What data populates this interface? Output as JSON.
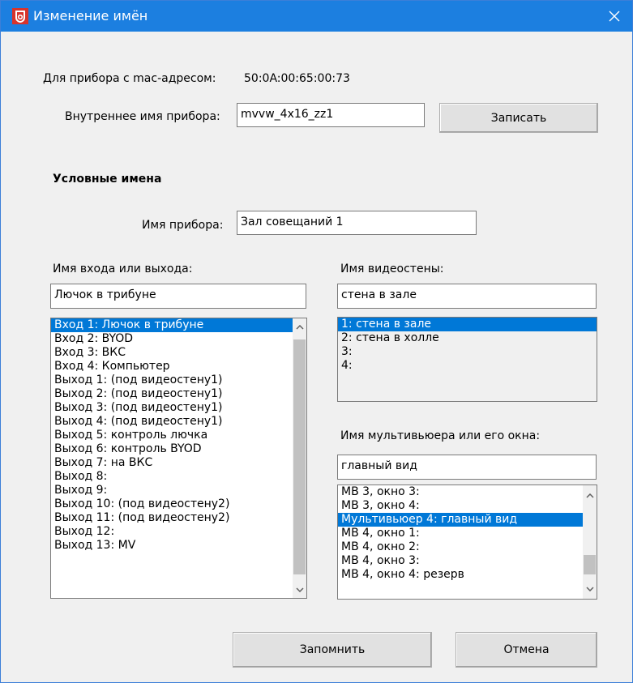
{
  "window": {
    "title": "Изменение имён"
  },
  "mac": {
    "label": "Для прибора с mac-адресом:",
    "value": "50:0A:00:65:00:73"
  },
  "internal": {
    "label": "Внутреннее имя прибора:",
    "value": "mvvw_4x16_zz1",
    "write_label": "Записать"
  },
  "conditional_header": "Условные имена",
  "device": {
    "label": "Имя прибора:",
    "value": "Зал совещаний 1"
  },
  "io": {
    "label": "Имя входа или выхода:",
    "value": "Лючок в трибуне",
    "items": [
      "Вход 1: Лючок в трибуне",
      "Вход 2: BYOD",
      "Вход 3: ВКС",
      "Вход 4: Компьютер",
      "Выход 1: (под видеостену1)",
      "Выход 2: (под видеостену1)",
      "Выход 3: (под видеостену1)",
      "Выход 4: (под видеостену1)",
      "Выход 5: контроль лючка",
      "Выход 6: контроль BYOD",
      "Выход 7: на ВКС",
      "Выход 8:",
      "Выход 9:",
      "Выход 10: (под видеостену2)",
      "Выход 11: (под видеостену2)",
      "Выход 12:",
      "Выход 13: MV"
    ],
    "selected": 0
  },
  "videowall": {
    "label": "Имя видеостены:",
    "value": "стена в зале",
    "items": [
      "1: стена в зале",
      "2: стена в холле",
      "3:",
      "4:"
    ],
    "selected": 0
  },
  "multiviewer": {
    "label": "Имя мультивьюера или его окна:",
    "value": "главный вид",
    "items": [
      "МВ 3, окно 3:",
      "МВ 3, окно 4:",
      "Мультивьюер 4: главный вид",
      "МВ 4, окно 1:",
      "МВ 4, окно 2:",
      "МВ 4, окно 3:",
      "МВ 4, окно 4: резерв"
    ],
    "selected": 2
  },
  "footer": {
    "save_label": "Запомнить",
    "cancel_label": "Отмена"
  },
  "colors": {
    "titlebar": "#1c7fe0",
    "selection": "#0078d7",
    "window_bg": "#f0f0f0"
  }
}
